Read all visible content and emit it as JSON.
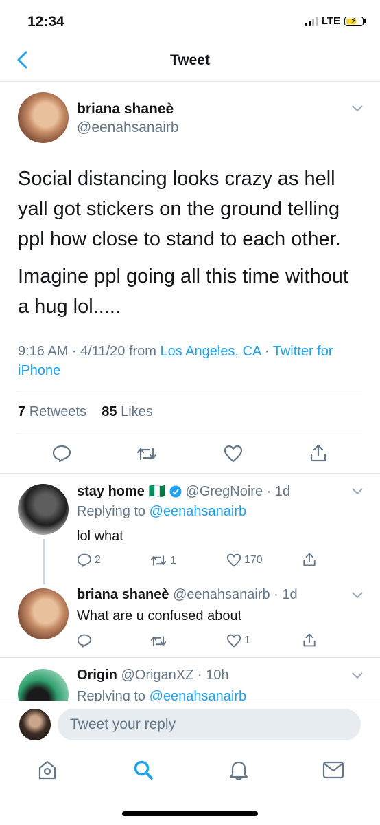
{
  "status_bar": {
    "time": "12:34",
    "network": "LTE"
  },
  "header": {
    "title": "Tweet"
  },
  "main_tweet": {
    "author_name": "briana shaneè",
    "author_handle": "@eenahsanairb",
    "text_p1": "Social distancing looks crazy as hell yall got stickers on the ground telling ppl how close to stand to each other.",
    "text_p2": "Imagine ppl going all this time without a hug lol.....",
    "time": "9:16 AM · 4/11/20 from ",
    "location": "Los Angeles, CA",
    "separator": " · ",
    "source": "Twitter for iPhone",
    "retweets_count": "7",
    "retweets_label": "Retweets",
    "likes_count": "85",
    "likes_label": "Likes"
  },
  "replies": [
    {
      "author_name": "stay home 🇳🇬",
      "author_handle": "@GregNoire",
      "age": "· 1d",
      "replying_to_label": "Replying to ",
      "replying_to": "@eenahsanairb",
      "text": "lol what",
      "reply_count": "2",
      "retweet_count": "1",
      "like_count": "170"
    },
    {
      "author_name": "briana shaneè",
      "author_handle": "@eenahsanairb",
      "age": "· 1d",
      "text": "What are u confused about",
      "like_count": "1"
    },
    {
      "author_name": "Origin",
      "author_handle": "@OriganXZ",
      "age": "· 10h",
      "replying_to_label": "Replying to ",
      "replying_to": "@eenahsanairb"
    }
  ],
  "composer": {
    "placeholder": "Tweet your reply"
  },
  "colors": {
    "accent": "#1da1f2",
    "secondary_text": "#657786",
    "divider": "#e1e8ed"
  }
}
